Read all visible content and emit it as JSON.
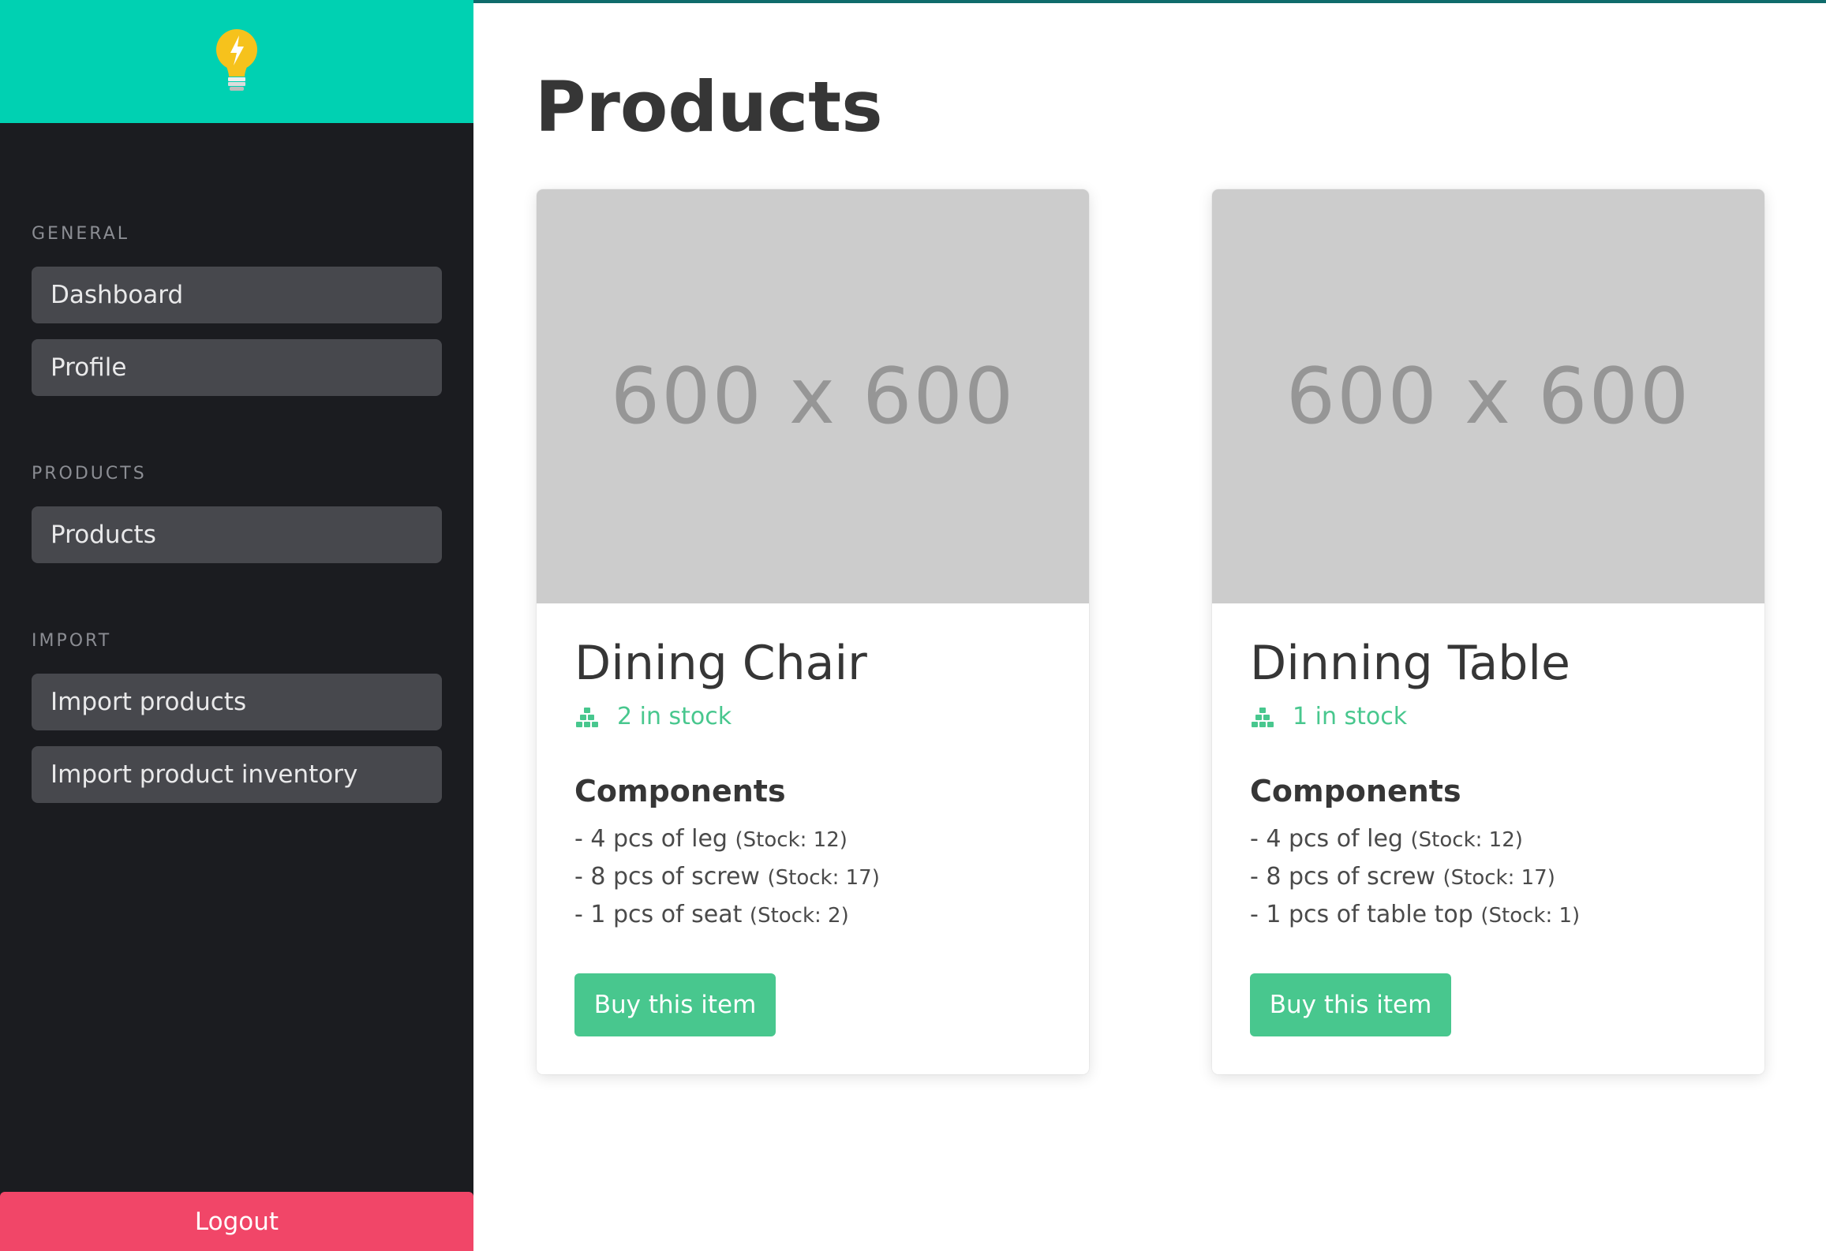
{
  "sidebar": {
    "logo_icon": "lightbulb-icon",
    "sections": [
      {
        "label": "GENERAL",
        "items": [
          {
            "label": "Dashboard"
          },
          {
            "label": "Profile"
          }
        ]
      },
      {
        "label": "PRODUCTS",
        "items": [
          {
            "label": "Products"
          }
        ]
      },
      {
        "label": "IMPORT",
        "items": [
          {
            "label": "Import products"
          },
          {
            "label": "Import product inventory"
          }
        ]
      }
    ],
    "logout_label": "Logout"
  },
  "main": {
    "title": "Products",
    "products": [
      {
        "image_placeholder": "600 x 600",
        "name": "Dining Chair",
        "stock_text": "2 in stock",
        "components_title": "Components",
        "components": [
          {
            "text": "- 4 pcs of leg",
            "stock": "(Stock: 12)"
          },
          {
            "text": "- 8 pcs of screw",
            "stock": "(Stock: 17)"
          },
          {
            "text": "- 1 pcs of seat",
            "stock": "(Stock: 2)"
          }
        ],
        "buy_label": "Buy this item"
      },
      {
        "image_placeholder": "600 x 600",
        "name": "Dinning Table",
        "stock_text": "1 in stock",
        "components_title": "Components",
        "components": [
          {
            "text": "- 4 pcs of leg",
            "stock": "(Stock: 12)"
          },
          {
            "text": "- 8 pcs of screw",
            "stock": "(Stock: 17)"
          },
          {
            "text": "- 1 pcs of table top",
            "stock": "(Stock: 1)"
          }
        ],
        "buy_label": "Buy this item"
      }
    ]
  },
  "colors": {
    "brand": "#00d1b2",
    "sidebar_bg": "#1b1c20",
    "nav_item_bg": "#47484d",
    "success": "#48c78e",
    "logout": "#f14668",
    "placeholder_bg": "#cccccc"
  }
}
